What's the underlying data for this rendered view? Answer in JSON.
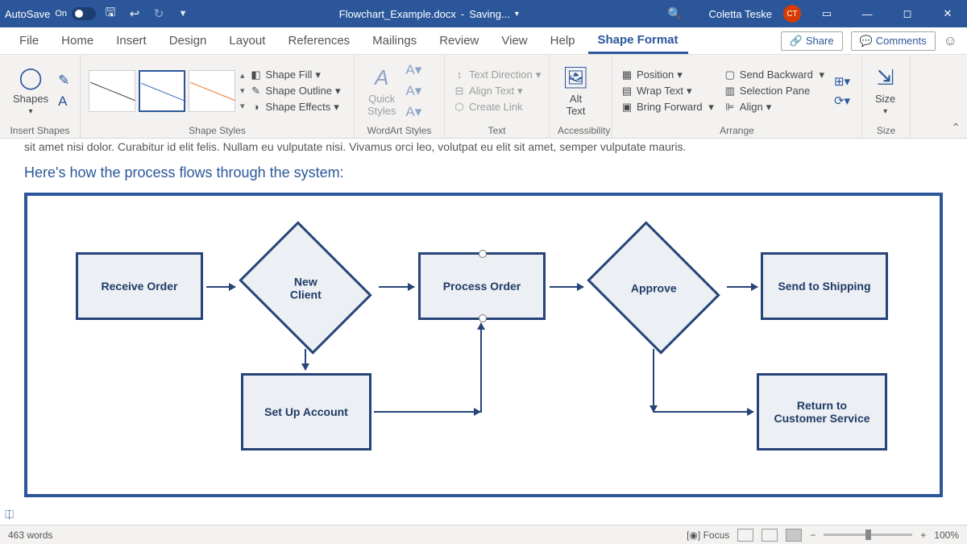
{
  "titlebar": {
    "autosave_label": "AutoSave",
    "autosave_state": "On",
    "doc_title": "Flowchart_Example.docx",
    "saving_label": "Saving...",
    "user_name": "Coletta Teske",
    "user_initials": "CT"
  },
  "tabs": {
    "file": "File",
    "home": "Home",
    "insert": "Insert",
    "design": "Design",
    "layout": "Layout",
    "references": "References",
    "mailings": "Mailings",
    "review": "Review",
    "view": "View",
    "help": "Help",
    "shape_format": "Shape Format",
    "share": "Share",
    "comments": "Comments"
  },
  "ribbon": {
    "insert_shapes": {
      "shapes": "Shapes",
      "label": "Insert Shapes"
    },
    "shape_styles": {
      "fill": "Shape Fill",
      "outline": "Shape Outline",
      "effects": "Shape Effects",
      "label": "Shape Styles"
    },
    "wordart": {
      "quick_styles": "Quick\nStyles",
      "label": "WordArt Styles"
    },
    "text": {
      "direction": "Text Direction",
      "align": "Align Text",
      "create_link": "Create Link",
      "label": "Text"
    },
    "accessibility": {
      "alt_text": "Alt\nText",
      "label": "Accessibility"
    },
    "arrange": {
      "position": "Position",
      "wrap": "Wrap Text",
      "bring_forward": "Bring Forward",
      "send_backward": "Send Backward",
      "selection_pane": "Selection Pane",
      "align": "Align",
      "label": "Arrange"
    },
    "size": {
      "size": "Size",
      "label": "Size"
    }
  },
  "document": {
    "partial_line": "sit amet nisi dolor. Curabitur id elit felis. Nullam eu vulputate nisi. Vivamus orci leo, volutpat eu elit sit amet, semper vulputate mauris.",
    "intro": "Here's how the process flows through the system:",
    "nodes": {
      "receive": "Receive Order",
      "new_client": "New\nClient",
      "process": "Process Order",
      "approve": "Approve",
      "ship": "Send to Shipping",
      "setup": "Set Up Account",
      "return": "Return to\nCustomer Service"
    }
  },
  "statusbar": {
    "words": "463 words",
    "focus": "Focus",
    "zoom": "100%"
  }
}
